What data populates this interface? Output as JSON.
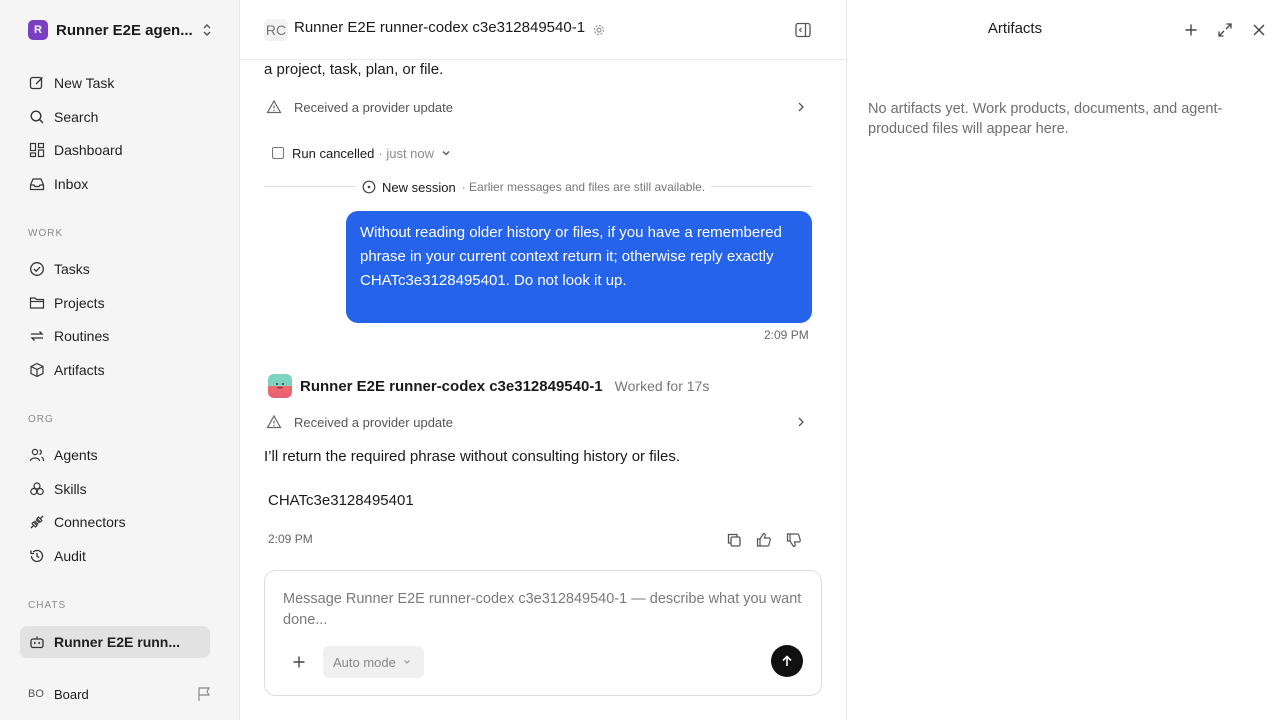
{
  "sidebar": {
    "workspace": {
      "logo_text": "R",
      "name": "Runner E2E agen..."
    },
    "main_items": [
      {
        "label": "New Task",
        "icon": "edit-icon"
      },
      {
        "label": "Search",
        "icon": "search-icon"
      },
      {
        "label": "Dashboard",
        "icon": "dashboard-icon"
      },
      {
        "label": "Inbox",
        "icon": "inbox-icon"
      }
    ],
    "work_label": "WORK",
    "work_items": [
      {
        "label": "Tasks",
        "icon": "check-circle-icon"
      },
      {
        "label": "Projects",
        "icon": "folder-icon"
      },
      {
        "label": "Routines",
        "icon": "repeat-icon"
      },
      {
        "label": "Artifacts",
        "icon": "box-icon"
      }
    ],
    "org_label": "ORG",
    "org_items": [
      {
        "label": "Agents",
        "icon": "users-icon"
      },
      {
        "label": "Skills",
        "icon": "skills-icon"
      },
      {
        "label": "Connectors",
        "icon": "plug-icon"
      },
      {
        "label": "Audit",
        "icon": "history-icon"
      }
    ],
    "chats_label": "CHATS",
    "chats": [
      {
        "label": "Runner E2E runn...",
        "icon": "bot-icon",
        "active": true
      }
    ],
    "user": {
      "initials": "BO",
      "name": "Board"
    }
  },
  "chat": {
    "header": {
      "initials": "RC",
      "title": "Runner E2E runner-codex c3e312849540-1"
    },
    "previous_tail": "a project, task, plan, or file.",
    "provider_update_1": "Received a provider update",
    "run_cancelled": {
      "label": "Run cancelled",
      "time": "· just now"
    },
    "new_session": {
      "label": "New session",
      "note": "· Earlier messages and files are still available."
    },
    "user_message": {
      "text": "Without reading older history or files, if you have a remembered phrase in your current context return it; otherwise reply exactly CHATc3e3128495401. Do not look it up.",
      "time": "2:09 PM"
    },
    "agent": {
      "name": "Runner E2E runner-codex c3e312849540-1",
      "worked": "Worked for 17s"
    },
    "provider_update_2": "Received a provider update",
    "agent_reply": "I’ll return the required phrase without consulting history or files.",
    "agent_code": "CHATc3e3128495401",
    "agent_time": "2:09 PM",
    "composer": {
      "placeholder": "Message Runner E2E runner-codex c3e312849540-1 — describe what you want done...",
      "mode": "Auto mode"
    }
  },
  "artifacts": {
    "title": "Artifacts",
    "empty_text": "No artifacts yet. Work products, documents, and agent-produced files will appear here."
  },
  "colors": {
    "accent": "#2563eb",
    "sidebar_bg": "#f5f5f5",
    "workspace_logo": "#7b3fc4"
  }
}
